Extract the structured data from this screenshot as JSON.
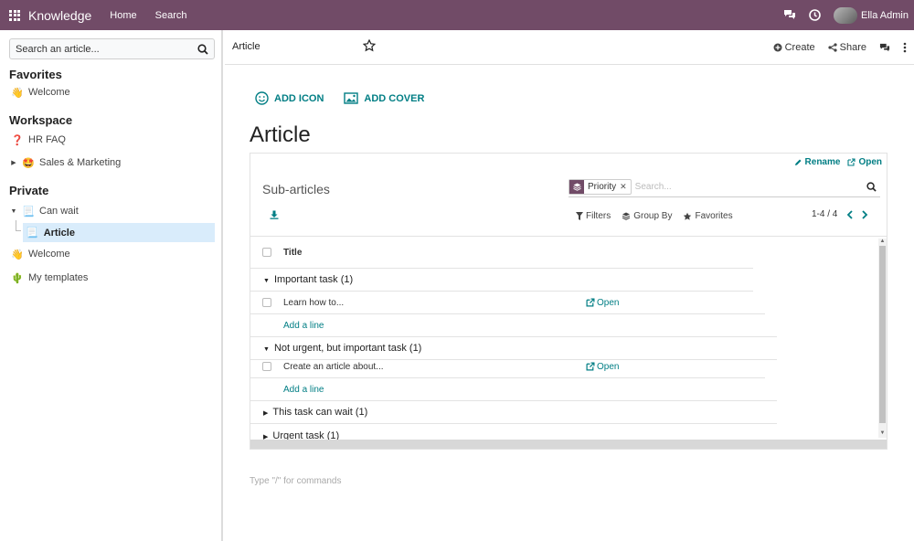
{
  "topbar": {
    "app_name": "Knowledge",
    "nav": [
      "Home",
      "Search"
    ],
    "user_name": "Ella Admin"
  },
  "sidebar": {
    "search_placeholder": "Search an article...",
    "favorites_heading": "Favorites",
    "favorites": [
      {
        "emoji": "👋",
        "label": "Welcome"
      }
    ],
    "workspace_heading": "Workspace",
    "workspace": [
      {
        "emoji": "❓",
        "label": "HR FAQ"
      },
      {
        "emoji": "🤩",
        "label": "Sales & Marketing"
      }
    ],
    "private_heading": "Private",
    "private": [
      {
        "emoji": "📃",
        "label": "Can wait"
      },
      {
        "emoji": "📃",
        "label": "Article"
      },
      {
        "emoji": "👋",
        "label": "Welcome"
      },
      {
        "emoji": "🌵",
        "label": "My templates"
      }
    ]
  },
  "header": {
    "breadcrumb": "Article",
    "create_label": "Create",
    "share_label": "Share"
  },
  "article": {
    "add_icon_label": "ADD ICON",
    "add_cover_label": "ADD COVER",
    "title": "Article",
    "command_hint": "Type \"/\" for commands"
  },
  "embed": {
    "rename_label": "Rename",
    "open_label": "Open",
    "title": "Sub-articles",
    "facet_label": "Priority",
    "search_placeholder": "Search...",
    "filters_label": "Filters",
    "group_by_label": "Group By",
    "favorites_label": "Favorites",
    "pager": "1-4 / 4",
    "column_title": "Title",
    "groups": [
      {
        "label": "Important task (1)",
        "record": "Learn how to...",
        "open": "Open",
        "add_line": "Add a line"
      },
      {
        "label": "Not urgent, but important task (1)",
        "record": "Create an article about...",
        "open": "Open",
        "add_line": "Add a line"
      },
      {
        "label": "This task can wait (1)"
      },
      {
        "label": "Urgent task (1)"
      }
    ]
  },
  "colors": {
    "brand": "#714b67",
    "accent": "#017e84",
    "active_item": "#d9ecfb"
  }
}
